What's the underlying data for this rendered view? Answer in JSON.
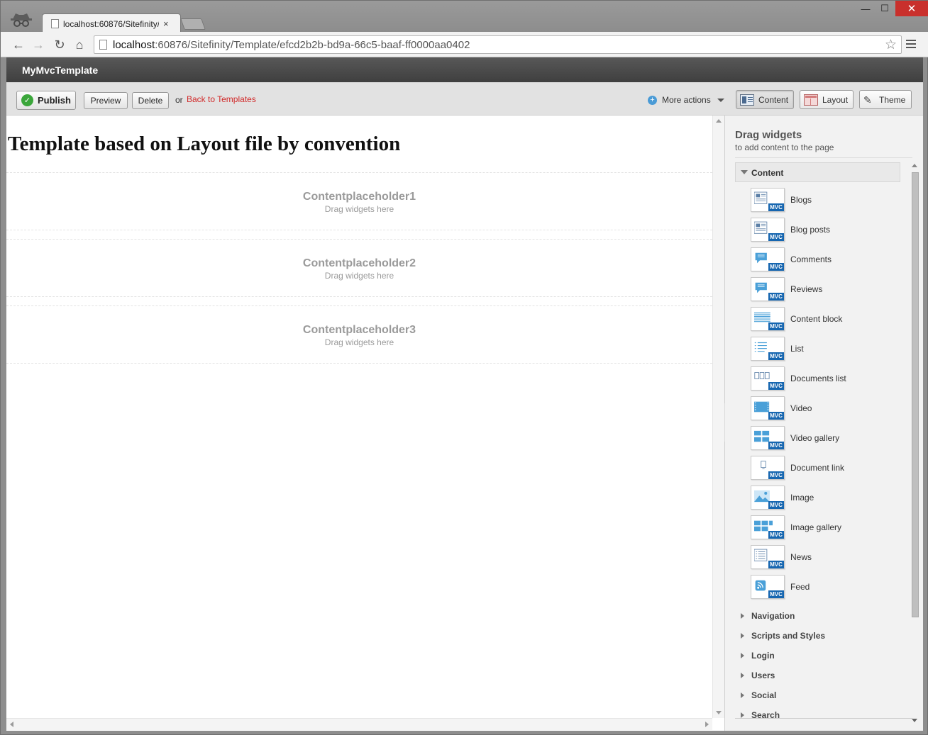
{
  "browser": {
    "tab_title": "localhost:60876/Sitefinity/",
    "tab_close": "×",
    "url_host": "localhost",
    "url_rest": ":60876/Sitefinity/Template/efcd2b2b-bd9a-66c5-baaf-ff0000aa0402",
    "window_min": "—",
    "window_max": "☐",
    "window_close": "✕"
  },
  "app": {
    "title": "MyMvcTemplate"
  },
  "actions": {
    "publish": "Publish",
    "preview": "Preview",
    "delete": "Delete",
    "or": "or",
    "back": "Back to Templates",
    "more": "More actions"
  },
  "modes": {
    "content": "Content",
    "layout": "Layout",
    "theme": "Theme"
  },
  "canvas": {
    "heading": "Template based on Layout file by convention",
    "placeholders": [
      {
        "title": "Contentplaceholder1",
        "hint": "Drag widgets here"
      },
      {
        "title": "Contentplaceholder2",
        "hint": "Drag widgets here"
      },
      {
        "title": "Contentplaceholder3",
        "hint": "Drag widgets here"
      }
    ]
  },
  "panel": {
    "title": "Drag widgets",
    "subtitle": "to add content to the page",
    "open_section": "Content",
    "badge": "MVC",
    "widgets": [
      {
        "label": "Blogs",
        "icon": "blogs-icon"
      },
      {
        "label": "Blog posts",
        "icon": "blog-posts-icon"
      },
      {
        "label": "Comments",
        "icon": "comments-icon"
      },
      {
        "label": "Reviews",
        "icon": "reviews-icon"
      },
      {
        "label": "Content block",
        "icon": "content-block-icon"
      },
      {
        "label": "List",
        "icon": "list-icon"
      },
      {
        "label": "Documents list",
        "icon": "documents-list-icon"
      },
      {
        "label": "Video",
        "icon": "video-icon"
      },
      {
        "label": "Video gallery",
        "icon": "video-gallery-icon"
      },
      {
        "label": "Document link",
        "icon": "document-link-icon"
      },
      {
        "label": "Image",
        "icon": "image-icon"
      },
      {
        "label": "Image gallery",
        "icon": "image-gallery-icon"
      },
      {
        "label": "News",
        "icon": "news-icon"
      },
      {
        "label": "Feed",
        "icon": "feed-icon"
      }
    ],
    "categories": [
      "Navigation",
      "Scripts and Styles",
      "Login",
      "Users",
      "Social",
      "Search"
    ]
  },
  "colors": {
    "accent_link": "#d12a2a",
    "mvc_badge": "#1666b0",
    "publish_check": "#3aa63a"
  }
}
